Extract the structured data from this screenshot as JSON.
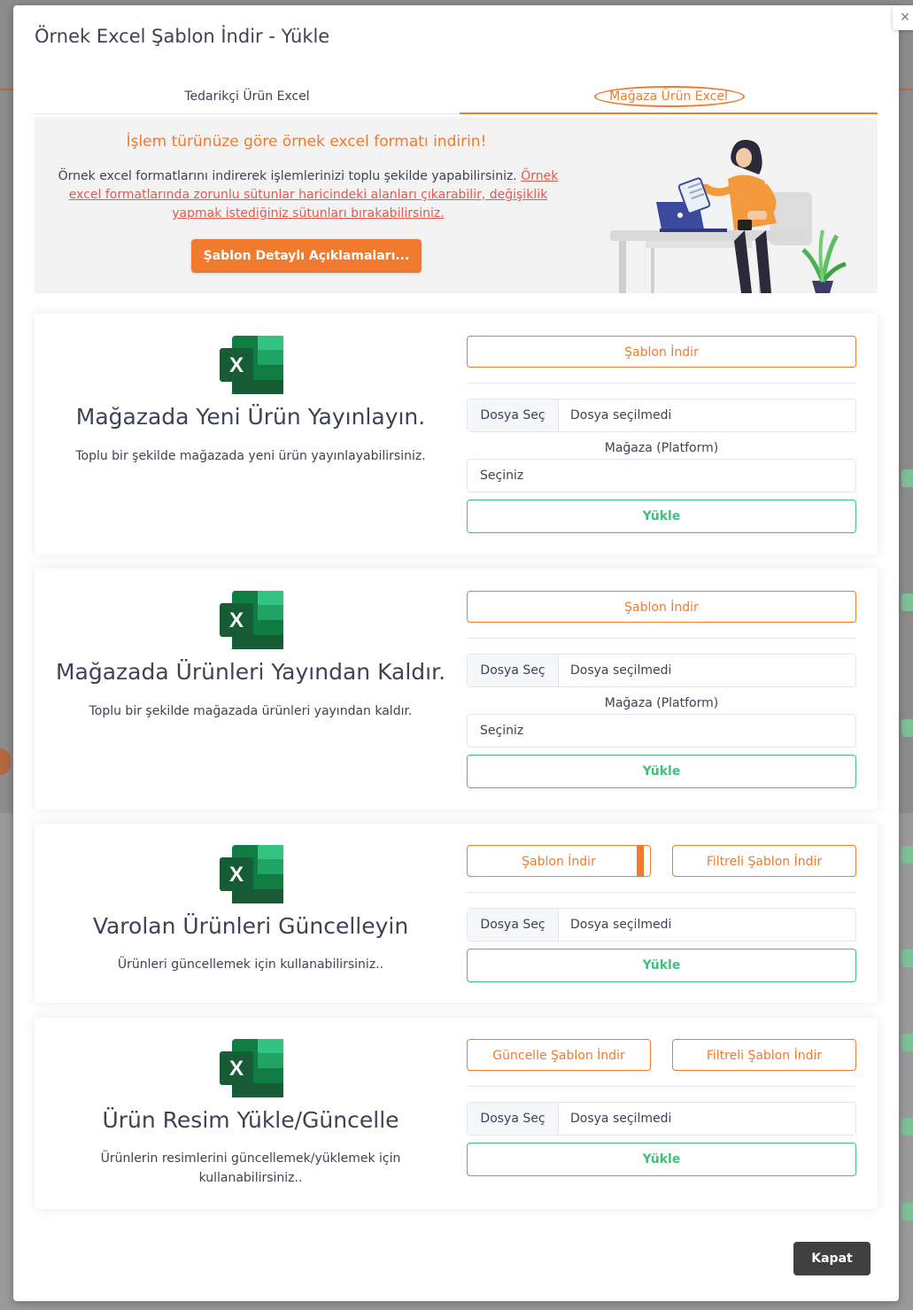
{
  "modal": {
    "title": "Örnek Excel Şablon İndir - Yükle",
    "close_label": "×"
  },
  "tabs": [
    {
      "label": "Tedarikçi Ürün Excel",
      "active": false
    },
    {
      "label": "Mağaza Ürün Excel",
      "active": true
    }
  ],
  "info": {
    "title": "İşlem türünüze göre örnek excel formatı indirin!",
    "text_plain": "Örnek excel formatlarını indirerek işlemlerinizi toplu şekilde yapabilirsiniz. ",
    "text_warning": "Örnek excel formatlarında zorunlu sütunlar haricindeki alanları çıkarabilir, değişiklik yapmak istediğiniz sütunları bırakabilirsiniz.",
    "detail_button": "Şablon Detaylı Açıklamaları..."
  },
  "cards": [
    {
      "title": "Mağazada Yeni Ürün Yayınlayın.",
      "description": "Toplu bir şekilde mağazada yeni ürün yayınlayabilirsiniz.",
      "download_button": "Şablon İndir",
      "file_button": "Dosya Seç",
      "file_text": "Dosya seçilmedi",
      "platform_label": "Mağaza (Platform)",
      "platform_select": "Seçiniz",
      "upload_button": "Yükle"
    },
    {
      "title": "Mağazada Ürünleri Yayından Kaldır.",
      "description": "Toplu bir şekilde mağazada ürünleri yayından kaldır.",
      "download_button": "Şablon İndir",
      "file_button": "Dosya Seç",
      "file_text": "Dosya seçilmedi",
      "platform_label": "Mağaza (Platform)",
      "platform_select": "Seçiniz",
      "upload_button": "Yükle"
    },
    {
      "title": "Varolan Ürünleri Güncelleyin",
      "description": "Ürünleri güncellemek için kullanabilirsiniz..",
      "download_button": "Şablon İndir",
      "filtered_button": "Filtreli Şablon İndir",
      "file_button": "Dosya Seç",
      "file_text": "Dosya seçilmedi",
      "upload_button": "Yükle"
    },
    {
      "title": "Ürün Resim Yükle/Güncelle",
      "description_line1": "Ürünlerin resimlerini güncellemek/yüklemek için",
      "description_line2": "kullanabilirsiniz..",
      "download_button": "Güncelle Şablon İndir",
      "filtered_button": "Filtreli Şablon İndir",
      "file_button": "Dosya Seç",
      "file_text": "Dosya seçilmedi",
      "upload_button": "Yükle"
    }
  ],
  "footer": {
    "close_button": "Kapat"
  },
  "colors": {
    "accent": "#f07a2e",
    "success": "#3ec17a",
    "text": "#3f4254",
    "excel_green": "#1d6f42"
  }
}
